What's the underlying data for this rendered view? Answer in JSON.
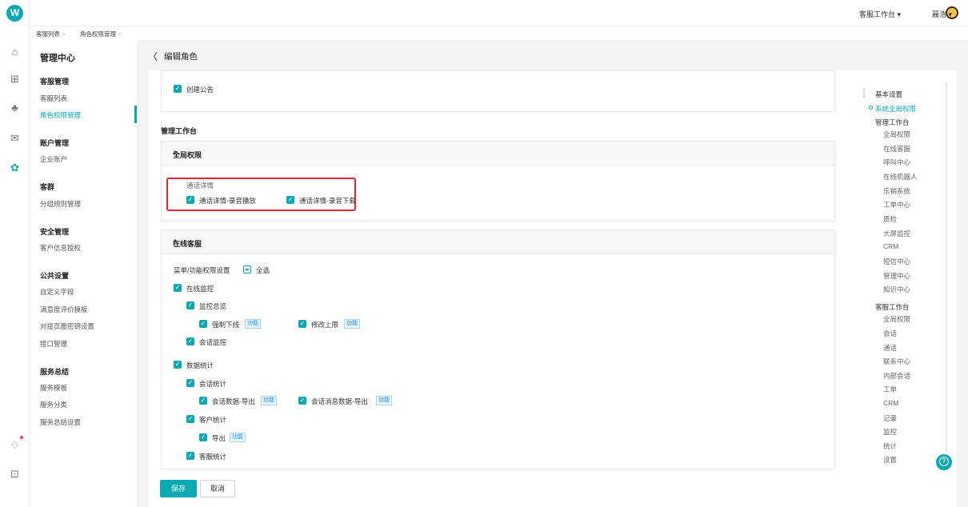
{
  "colors": {
    "accent": "#0ba9b3",
    "highlight": "#e5262c",
    "tag": "#1890ff"
  },
  "rail": {
    "logo": "W",
    "icons": [
      "home-icon",
      "apps-icon",
      "people-icon",
      "mail-icon",
      "gear-icon",
      "bell-icon",
      "download-icon"
    ]
  },
  "topbar": {
    "workspace": "客服工作台 ▾",
    "user": "聂浩 ▾"
  },
  "tabs": [
    {
      "label": "客服列表"
    },
    {
      "label": "角色权限管理"
    }
  ],
  "sidebar": {
    "title": "管理中心",
    "groups": [
      {
        "head": "客服管理",
        "items": [
          "客服列表",
          "角色权限管理"
        ]
      },
      {
        "head": "账户管理",
        "items": [
          "企业账户"
        ]
      },
      {
        "head": "客群",
        "items": [
          "分组规则管理"
        ]
      },
      {
        "head": "安全管理",
        "items": [
          "客户信息授权"
        ]
      },
      {
        "head": "公共设置",
        "items": [
          "自定义字段",
          "满意度评价模板",
          "对接页面密钥设置",
          "接口管理"
        ]
      },
      {
        "head": "服务总结",
        "items": [
          "服务模板",
          "服务分类",
          "服务总结设置"
        ]
      }
    ]
  },
  "page": {
    "back": "〈",
    "title": "编辑角色"
  },
  "content": {
    "create_notice": "创建公告",
    "section_title": "管理工作台",
    "global": {
      "title": "全局权限",
      "group_label": "通话详情",
      "options": [
        "通话详情-录音播放",
        "通话详情-录音下载"
      ]
    },
    "online": {
      "title": "在线客服",
      "menu_label": "菜单/功能权限设置",
      "select_all": "全选",
      "tag": "功能",
      "n1": "在线监控",
      "n1a": "监控总览",
      "n1a1": "强制下线",
      "n1a2": "修改上限",
      "n1b": "会话监控",
      "n2": "数据统计",
      "n2a": "会话统计",
      "n2a1": "会话数据-导出",
      "n2a2": "会话消息数据-导出",
      "n2b": "客户统计",
      "n2b1": "导出",
      "n2c": "客服统计"
    },
    "caret": "^"
  },
  "anchor": {
    "items": [
      "基本设置",
      "系统全局权限",
      "管理工作台",
      "全局权限",
      "在线客服",
      "呼叫中心",
      "在线机器人",
      "乐销系统",
      "工单中心",
      "质检",
      "大屏监控",
      "CRM",
      "短信中心",
      "管理中心",
      "知识中心",
      "客服工作台",
      "全局权限",
      "会话",
      "通话",
      "联系中心",
      "内部会话",
      "工单",
      "CRM",
      "记录",
      "监控",
      "统计",
      "设置"
    ]
  },
  "footer": {
    "save": "保存",
    "cancel": "取消"
  },
  "help": "?"
}
